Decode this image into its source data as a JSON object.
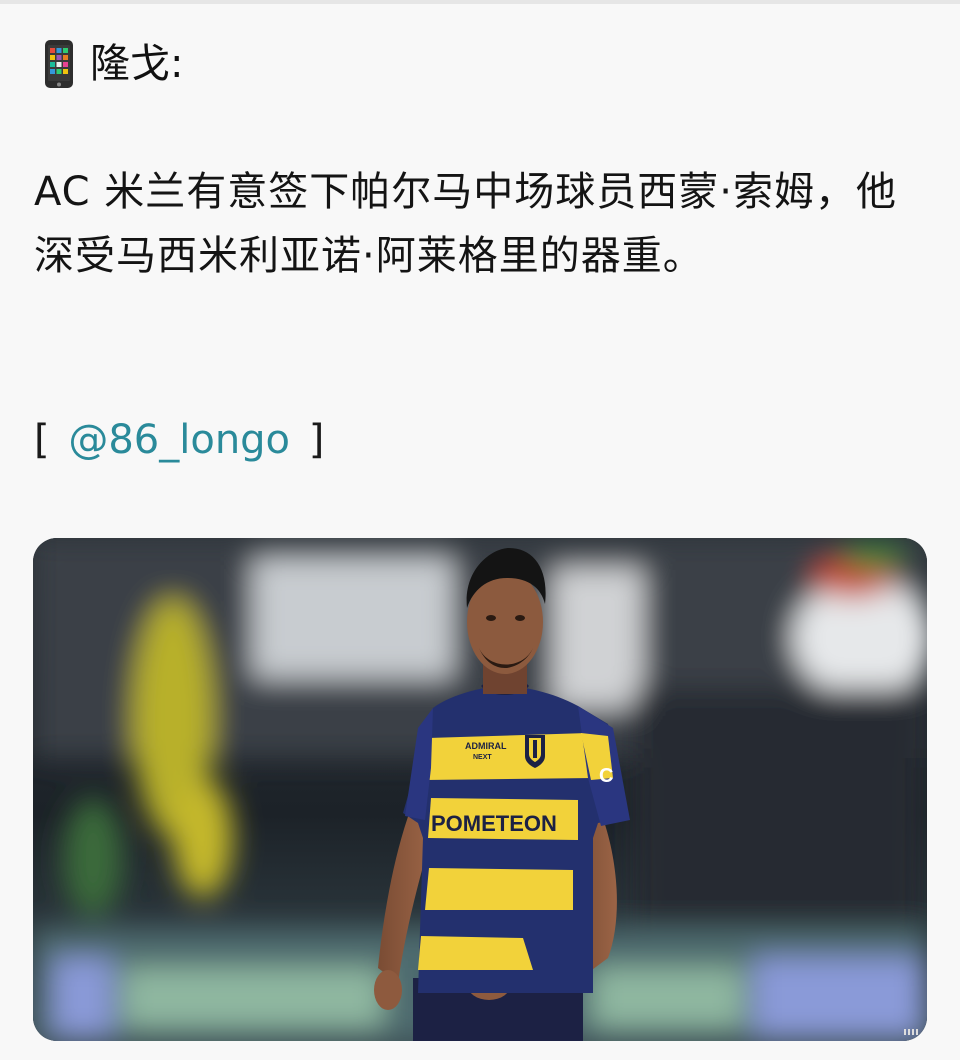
{
  "post": {
    "author_icon": "mobile-phone-icon",
    "author": "隆戈:",
    "text": "AC 米兰有意签下帕尔马中场球员西蒙·索姆，他深受马西米利亚诺·阿莱格里的器重。",
    "source_open": "[",
    "mention": "@86_longo",
    "source_close": "]"
  },
  "photo": {
    "description_icon": "football-player-photo",
    "jersey_sponsor": "POMETEON",
    "jersey_top_sponsor": "ADMIRAL",
    "jersey_top_sponsor_sub": "NEXT",
    "sleeve_text": "C"
  },
  "colors": {
    "mention": "#2a8a9a",
    "jersey_blue": "#23306e",
    "jersey_yellow": "#f2d23a"
  }
}
